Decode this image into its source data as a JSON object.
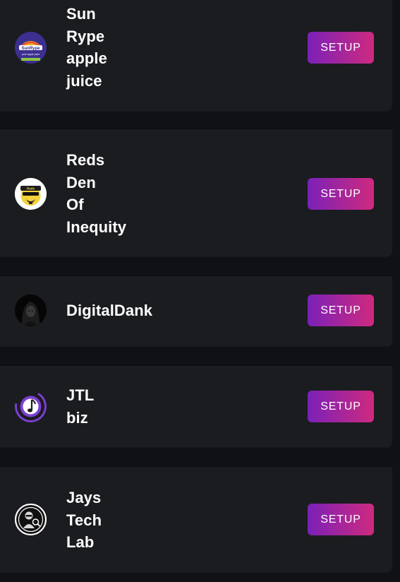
{
  "channels": [
    {
      "name": "Sun Rype apple juice",
      "button": "SETUP"
    },
    {
      "name": "Reds Den Of Inequity",
      "button": "SETUP"
    },
    {
      "name": "DigitalDank",
      "button": "SETUP"
    },
    {
      "name": "JTL biz",
      "button": "SETUP"
    },
    {
      "name": "Jays Tech Lab",
      "button": "SETUP"
    }
  ],
  "avatars": {
    "sunrype_logo_text": "SunRype",
    "sunrype_sub_text": "pure apple juice",
    "reds_hat_text": "Reds"
  },
  "colors": {
    "page_bg": "#0f1114",
    "card_bg": "#1b1c20",
    "button_gradient_start": "#7a21b8",
    "button_gradient_end": "#cf2a7e",
    "text": "#ffffff"
  },
  "icons": [
    "sunrype-logo-icon",
    "reds-den-avatar-icon",
    "hooded-figure-icon",
    "music-note-icon",
    "jays-tech-lab-logo-icon"
  ]
}
